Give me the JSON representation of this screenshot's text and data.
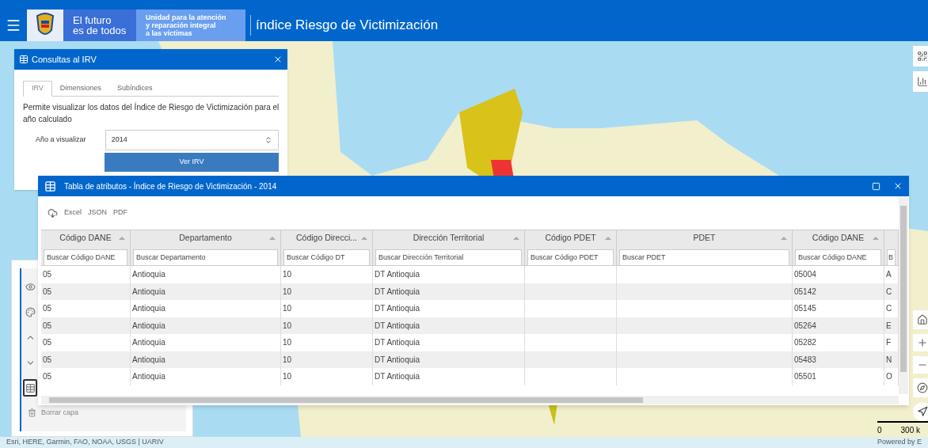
{
  "header": {
    "brand_lines": [
      "El futuro",
      "es de todos"
    ],
    "unit_lines": [
      "Unidad para la atención",
      "y reparación integral",
      "a las víctimas"
    ],
    "title": "índice Riesgo de Victimización"
  },
  "query_panel": {
    "title": "Consultas al IRV",
    "tabs": [
      {
        "label": "IRV",
        "selected": true
      },
      {
        "label": "Dimensiones",
        "selected": false
      },
      {
        "label": "Subíndices",
        "selected": false
      }
    ],
    "description": "Permite visualizar los datos del Índice de Riesgo de Victimización para el año calculado",
    "year_label": "Año a visualizar",
    "year_value": "2014",
    "button": "Ver IRV"
  },
  "layer_panel": {
    "tools": [
      {
        "kind": "eye",
        "selected": false
      },
      {
        "kind": "palette",
        "selected": false
      },
      {
        "kind": "up",
        "selected": false
      },
      {
        "kind": "down",
        "selected": false
      },
      {
        "kind": "table",
        "selected": true
      }
    ],
    "delete_label": "Borrar capa"
  },
  "table_window": {
    "title": "Tabla de atributos - Índice de Riesgo de Victimización - 2014",
    "exports": [
      "Excel",
      "JSON",
      "PDF"
    ],
    "columns": [
      {
        "label": "Código DANE",
        "placeholder": "Buscar Código DANE"
      },
      {
        "label": "Departamento",
        "placeholder": "Buscar Departamento"
      },
      {
        "label": "Código Direcci...",
        "placeholder": "Buscar Código DT"
      },
      {
        "label": "Dirección Territorial",
        "placeholder": "Buscar Dirección Territorial"
      },
      {
        "label": "Código PDET",
        "placeholder": "Buscar Código PDET"
      },
      {
        "label": "PDET",
        "placeholder": "Buscar PDET"
      },
      {
        "label": "Código DANE",
        "placeholder": "Buscar Código DANE"
      },
      {
        "placeholder": "B"
      }
    ],
    "rows": [
      [
        "05",
        "Antioquia",
        "10",
        "DT Antioquia",
        "",
        "",
        "05004",
        "A"
      ],
      [
        "05",
        "Antioquia",
        "10",
        "DT Antioquia",
        "",
        "",
        "05142",
        "C"
      ],
      [
        "05",
        "Antioquia",
        "10",
        "DT Antioquia",
        "",
        "",
        "05145",
        "C"
      ],
      [
        "05",
        "Antioquia",
        "10",
        "DT Antioquia",
        "",
        "",
        "05264",
        "E"
      ],
      [
        "05",
        "Antioquia",
        "10",
        "DT Antioquia",
        "",
        "",
        "05282",
        "F"
      ],
      [
        "05",
        "Antioquia",
        "10",
        "DT Antioquia",
        "",
        "",
        "05483",
        "N"
      ],
      [
        "05",
        "Antioquia",
        "10",
        "DT Antioquia",
        "",
        "",
        "05501",
        "O"
      ]
    ]
  },
  "map": {
    "attribution": "Esri, HERE, Garmin, FAO, NOAA, USGS | UARIV",
    "scale_labels": [
      "0",
      "300 k"
    ],
    "powered": "Powered by E"
  }
}
